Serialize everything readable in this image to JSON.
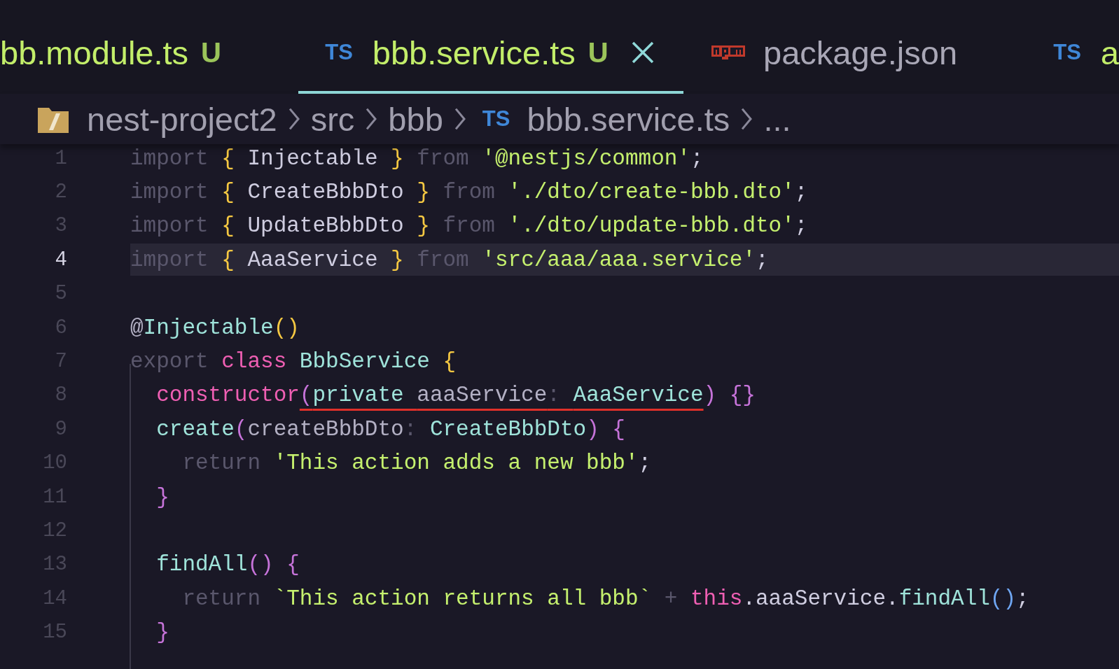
{
  "tabs": [
    {
      "label": "bb.module.ts",
      "status": "U",
      "kind": "plain",
      "selected": false,
      "modified": true
    },
    {
      "label": "bbb.service.ts",
      "badge": "TS",
      "status": "U",
      "kind": "ts",
      "selected": true,
      "modified": true
    },
    {
      "label": "package.json",
      "kind": "npm",
      "selected": false,
      "modified": false
    },
    {
      "label": "a",
      "badge": "TS",
      "kind": "ts",
      "selected": false,
      "modified": true
    }
  ],
  "breadcrumb": [
    {
      "kind": "folder",
      "label": "nest-project2"
    },
    {
      "kind": "plain",
      "label": "src"
    },
    {
      "kind": "plain",
      "label": "bbb"
    },
    {
      "kind": "ts",
      "badge": "TS",
      "label": "bbb.service.ts"
    },
    {
      "kind": "plain",
      "label": "..."
    }
  ],
  "lines": [
    {
      "number": "1",
      "current": false,
      "tokens": [
        {
          "kind": "keyword",
          "text": "import "
        },
        {
          "kind": "brace",
          "text": "{ "
        },
        {
          "kind": "name",
          "text": "Injectable "
        },
        {
          "kind": "brace",
          "text": "} "
        },
        {
          "kind": "keyword",
          "text": "from "
        },
        {
          "kind": "string",
          "text": "'@nestjs/common'"
        },
        {
          "kind": "name",
          "text": ";"
        }
      ]
    },
    {
      "number": "2",
      "current": false,
      "tokens": [
        {
          "kind": "keyword",
          "text": "import "
        },
        {
          "kind": "brace",
          "text": "{ "
        },
        {
          "kind": "name",
          "text": "CreateBbbDto "
        },
        {
          "kind": "brace",
          "text": "} "
        },
        {
          "kind": "keyword",
          "text": "from "
        },
        {
          "kind": "string",
          "text": "'./dto/create-bbb.dto'"
        },
        {
          "kind": "name",
          "text": ";"
        }
      ]
    },
    {
      "number": "3",
      "current": false,
      "tokens": [
        {
          "kind": "keyword",
          "text": "import "
        },
        {
          "kind": "brace",
          "text": "{ "
        },
        {
          "kind": "name",
          "text": "UpdateBbbDto "
        },
        {
          "kind": "brace",
          "text": "} "
        },
        {
          "kind": "keyword",
          "text": "from "
        },
        {
          "kind": "string",
          "text": "'./dto/update-bbb.dto'"
        },
        {
          "kind": "name",
          "text": ";"
        }
      ]
    },
    {
      "number": "4",
      "current": true,
      "tokens": [
        {
          "kind": "keyword",
          "text": "import "
        },
        {
          "kind": "brace",
          "text": "{ "
        },
        {
          "kind": "name",
          "text": "AaaService "
        },
        {
          "kind": "brace",
          "text": "} "
        },
        {
          "kind": "keyword",
          "text": "from "
        },
        {
          "kind": "string",
          "text": "'src/aaa/aaa.service'"
        },
        {
          "kind": "name",
          "text": ";"
        }
      ]
    },
    {
      "number": "5",
      "current": false
    },
    {
      "number": "6",
      "current": false,
      "tokens": [
        {
          "kind": "param",
          "text": "@"
        },
        {
          "kind": "type",
          "text": "Injectable"
        },
        {
          "kind": "brace",
          "text": "()"
        }
      ]
    },
    {
      "number": "7",
      "current": false,
      "tokens": [
        {
          "kind": "keyword",
          "text": "export "
        },
        {
          "kind": "pink",
          "text": "class "
        },
        {
          "kind": "type",
          "text": "BbbService "
        },
        {
          "kind": "brace",
          "text": "{"
        }
      ]
    },
    {
      "number": "8",
      "current": false,
      "tokens": [
        {
          "kind": "pink",
          "text": "  constructor"
        },
        {
          "kind": "paren",
          "text": "(",
          "underlined": true
        },
        {
          "kind": "type",
          "text": "private ",
          "underlined": true
        },
        {
          "kind": "param",
          "text": "aaaService",
          "underlined": true
        },
        {
          "kind": "keyword",
          "text": ": ",
          "underlined": true
        },
        {
          "kind": "type",
          "text": "AaaService",
          "underlined": true
        },
        {
          "kind": "paren",
          "text": ") {}"
        }
      ]
    },
    {
      "number": "9",
      "current": false,
      "tokens": [
        {
          "kind": "type",
          "text": "  create"
        },
        {
          "kind": "paren",
          "text": "("
        },
        {
          "kind": "param",
          "text": "createBbbDto"
        },
        {
          "kind": "keyword",
          "text": ": "
        },
        {
          "kind": "type",
          "text": "CreateBbbDto"
        },
        {
          "kind": "paren",
          "text": ") {"
        }
      ]
    },
    {
      "number": "10",
      "current": false,
      "tokens": [
        {
          "kind": "keyword",
          "text": "    return "
        },
        {
          "kind": "string",
          "text": "'This action adds a new bbb'"
        },
        {
          "kind": "name",
          "text": ";"
        }
      ]
    },
    {
      "number": "11",
      "current": false,
      "tokens": [
        {
          "kind": "paren",
          "text": "  }"
        }
      ]
    },
    {
      "number": "12",
      "current": false
    },
    {
      "number": "13",
      "current": false,
      "tokens": [
        {
          "kind": "type",
          "text": "  findAll"
        },
        {
          "kind": "paren",
          "text": "() {"
        }
      ]
    },
    {
      "number": "14",
      "current": false,
      "tokens": [
        {
          "kind": "keyword",
          "text": "    return "
        },
        {
          "kind": "string",
          "text": "`This action returns all bbb` "
        },
        {
          "kind": "keyword",
          "text": "+ "
        },
        {
          "kind": "pink",
          "text": "this"
        },
        {
          "kind": "name",
          "text": ".aaaService."
        },
        {
          "kind": "type",
          "text": "findAll"
        },
        {
          "kind": "blue",
          "text": "()"
        },
        {
          "kind": "name",
          "text": ";"
        }
      ]
    },
    {
      "number": "15",
      "current": false,
      "tokens": [
        {
          "kind": "paren",
          "text": "  }"
        }
      ]
    }
  ]
}
